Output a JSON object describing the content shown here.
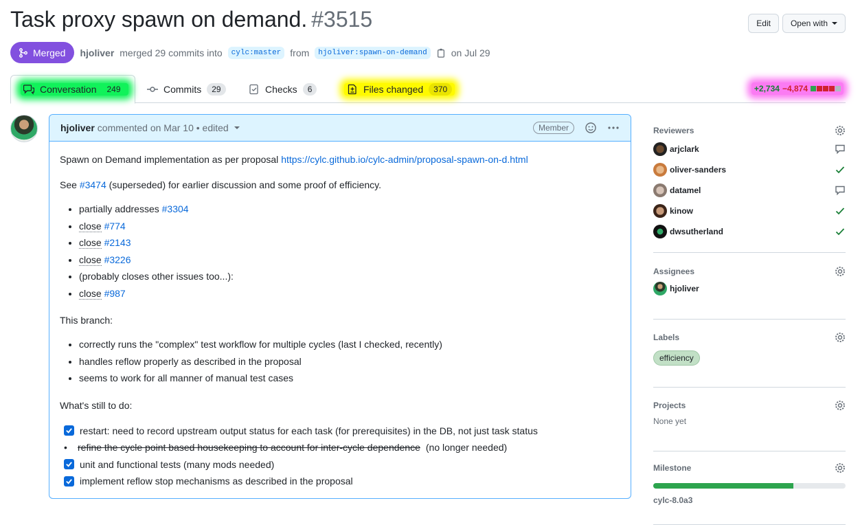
{
  "pr": {
    "title": "Task proxy spawn on demand.",
    "number": "#3515",
    "state": "Merged",
    "author": "hjoliver",
    "merged_text": "merged 29 commits into",
    "base_branch": "cylc:master",
    "from_text": "from",
    "head_branch": "hjoliver:spawn-on-demand",
    "date_text": "on Jul 29"
  },
  "header_buttons": {
    "edit": "Edit",
    "open_with": "Open with"
  },
  "tabs": [
    {
      "label": "Conversation",
      "count": "249"
    },
    {
      "label": "Commits",
      "count": "29"
    },
    {
      "label": "Checks",
      "count": "6"
    },
    {
      "label": "Files changed",
      "count": "370"
    }
  ],
  "diffstat": {
    "additions": "+2,734",
    "deletions": "−4,874"
  },
  "colors": {
    "merged": "#8250df",
    "link": "#0969da",
    "add": "#1a7f37",
    "del": "#cf222e",
    "highlight_green": "#11f25a",
    "highlight_yellow": "#fffa00",
    "highlight_pink": "#fb7bf3"
  },
  "comment": {
    "author": "hjoliver",
    "meta": "commented on Mar 10 • edited",
    "badge": "Member",
    "intro": "Spawn on Demand implementation as per proposal",
    "intro_link": "https://cylc.github.io/cylc-admin/proposal-spawn-on-d.html",
    "see_prefix": "See",
    "see_link": "#3474",
    "see_suffix": "(superseded) for earlier discussion and some proof of efficiency.",
    "refs": [
      {
        "text": "partially addresses",
        "link": "#3304"
      },
      {
        "text": "close",
        "link": "#774"
      },
      {
        "text": "close",
        "link": "#2143"
      },
      {
        "text": "close",
        "link": "#3226"
      },
      {
        "text": "(probably closes other issues too...):",
        "link": ""
      },
      {
        "text": "close",
        "link": "#987"
      }
    ],
    "branch_heading": "This branch:",
    "branch_items": [
      "correctly runs the \"complex\" test workflow for multiple cycles (last I checked, recently)",
      "handles reflow properly as described in the proposal",
      "seems to work for all manner of manual test cases"
    ],
    "todo_heading": "What's still to do:",
    "todos": [
      {
        "text": "restart: need to record upstream output status for each task (for prerequisites) in the DB, not just task status",
        "checked": true
      },
      {
        "text": "refine the cycle point based housekeeping to account for inter-cycle dependence",
        "suffix": "(no longer needed)",
        "struck": true
      },
      {
        "text": "unit and functional tests (many mods needed)",
        "checked": true
      },
      {
        "text": "implement reflow stop mechanisms as described in the proposal",
        "checked": true
      }
    ]
  },
  "sidebar": {
    "reviewers_title": "Reviewers",
    "reviewers": [
      {
        "name": "arjclark",
        "status": "comment-icon"
      },
      {
        "name": "oliver-sanders",
        "status": "check-icon"
      },
      {
        "name": "datamel",
        "status": "comment-icon"
      },
      {
        "name": "kinow",
        "status": "check-icon"
      },
      {
        "name": "dwsutherland",
        "status": "check-icon"
      }
    ],
    "assignees_title": "Assignees",
    "assignee": "hjoliver",
    "labels_title": "Labels",
    "label": "efficiency",
    "projects_title": "Projects",
    "projects_value": "None yet",
    "milestone_title": "Milestone",
    "milestone_progress": 0.73,
    "milestone_name": "cylc-8.0a3"
  }
}
